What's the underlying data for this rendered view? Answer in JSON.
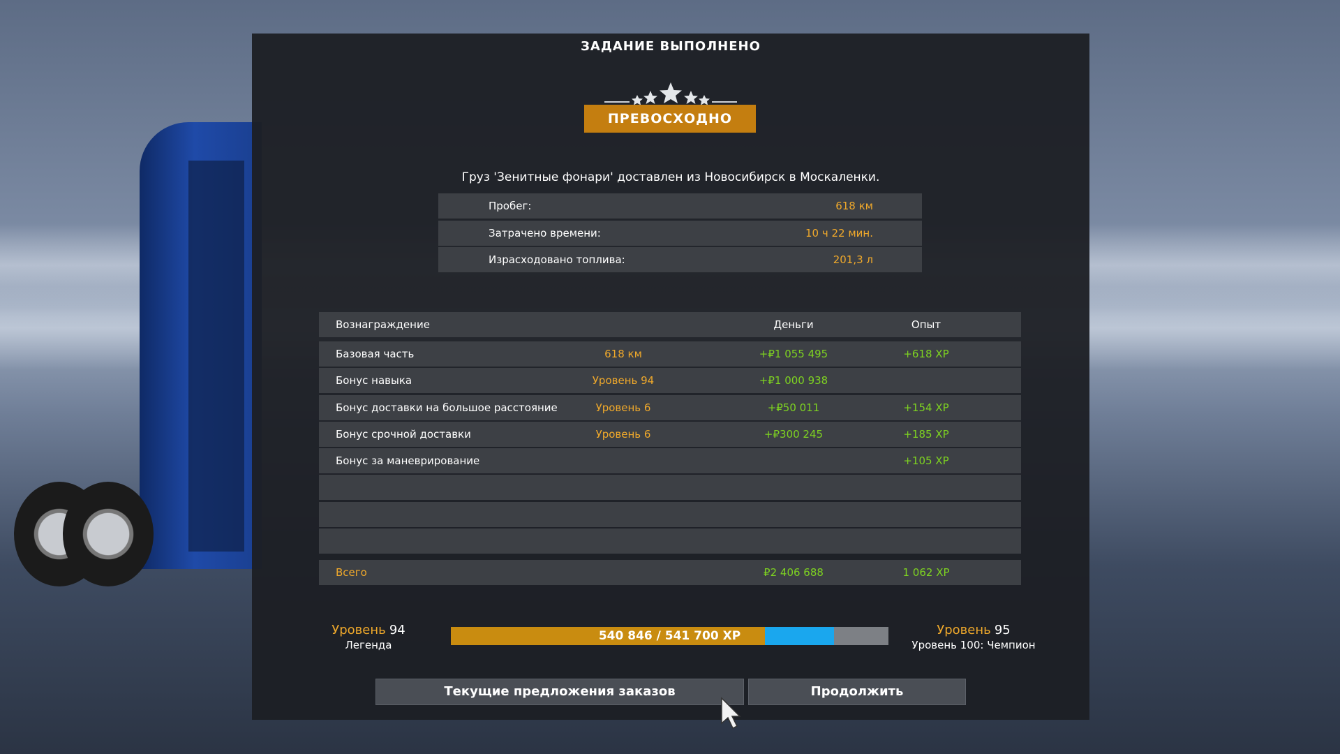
{
  "dialog": {
    "title": "ЗАДАНИЕ ВЫПОЛНЕНО",
    "rating_label": "ПРЕВОСХОДНО",
    "rating_stars": 5,
    "delivery_text": "Груз 'Зенитные фонари' доставлен из Новосибирск в Москаленки."
  },
  "stats": [
    {
      "label": "Пробег:",
      "value": "618 км"
    },
    {
      "label": "Затрачено времени:",
      "value": "10 ч 22 мин."
    },
    {
      "label": "Израсходовано топлива:",
      "value": "201,3 л"
    }
  ],
  "rewards": {
    "headers": {
      "reward": "Вознаграждение",
      "money": "Деньги",
      "xp": "Опыт"
    },
    "rows": [
      {
        "name": "Базовая часть",
        "detail": "618 км",
        "money": "+₽1 055 495",
        "xp": "+618 XP"
      },
      {
        "name": "Бонус навыка",
        "detail": "Уровень 94",
        "money": "+₽1 000 938",
        "xp": ""
      },
      {
        "name": "Бонус доставки на большое расстояние",
        "detail": "Уровень 6",
        "money": "+₽50 011",
        "xp": "+154 XP"
      },
      {
        "name": "Бонус срочной доставки",
        "detail": "Уровень 6",
        "money": "+₽300 245",
        "xp": "+185 XP"
      },
      {
        "name": "Бонус за маневрирование",
        "detail": "",
        "money": "",
        "xp": "+105 XP"
      },
      {
        "name": "",
        "detail": "",
        "money": "",
        "xp": ""
      },
      {
        "name": "",
        "detail": "",
        "money": "",
        "xp": ""
      },
      {
        "name": "",
        "detail": "",
        "money": "",
        "xp": ""
      }
    ],
    "total": {
      "name": "Всего",
      "money": "₽2 406 688",
      "xp": "1 062 XP"
    }
  },
  "level": {
    "word": "Уровень",
    "current": "94",
    "current_title": "Легенда",
    "next": "95",
    "next_title": "Уровень 100: Чемпион",
    "xp_text": "540 846 / 541 700 XP",
    "progress_earned_fraction": 0.718,
    "progress_gained_fraction": 0.157
  },
  "buttons": {
    "offers": "Текущие предложения заказов",
    "continue": "Продолжить"
  },
  "colors": {
    "accent": "#f0a92b",
    "badge": "#c47e10",
    "positive": "#7ed321",
    "xp_blue": "#1aa7ee"
  }
}
